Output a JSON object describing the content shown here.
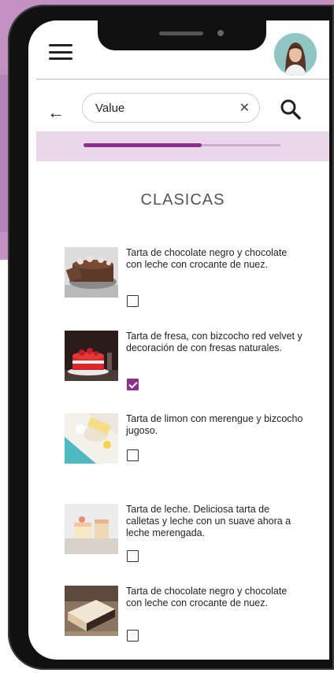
{
  "search": {
    "value": "Value",
    "clear_icon": "close-icon"
  },
  "progress": {
    "fraction": 0.6
  },
  "section": {
    "title": "CLASICAS"
  },
  "items": [
    {
      "description": "Tarta de chocolate negro y chocolate con leche con crocante de nuez.",
      "checked": false
    },
    {
      "description": "Tarta de fresa, con bizcocho red velvet y decoración de con fresas naturales.",
      "checked": true
    },
    {
      "description": "Tarta de limon con merengue y bizcocho jugoso.",
      "checked": false
    },
    {
      "description": "Tarta de leche. Deliciosa tarta de calletas y leche con un suave ahora a leche merengada.",
      "checked": false
    },
    {
      "description": "Tarta de chocolate negro y chocolate con leche con crocante de nuez.",
      "checked": false
    }
  ],
  "colors": {
    "accent": "#8d2f8c",
    "background": "#c48fc3",
    "strip": "#ead8ea"
  }
}
